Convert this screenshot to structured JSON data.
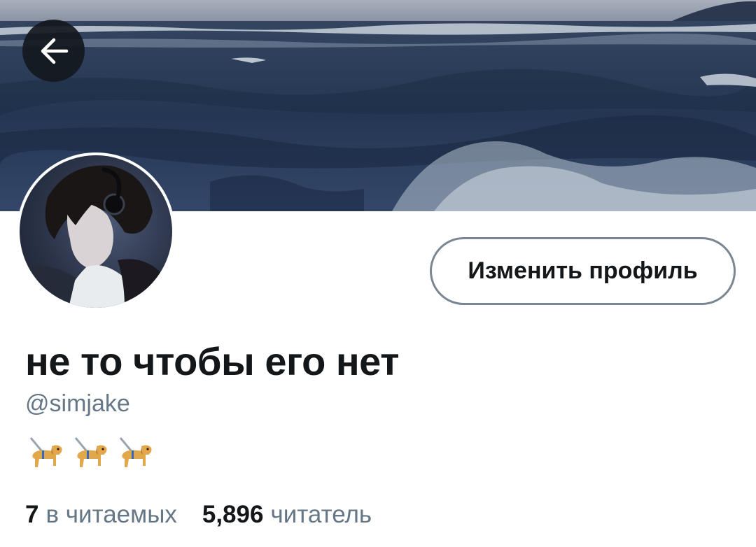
{
  "profile": {
    "display_name": "не то чтобы его нет",
    "handle": "@simjake",
    "bio_icons": [
      "guide-dog-emoji",
      "guide-dog-emoji",
      "guide-dog-emoji"
    ],
    "edit_button_label": "Изменить профиль"
  },
  "stats": {
    "following_count": "7",
    "following_label": "в читаемых",
    "followers_count": "5,896",
    "followers_label": "читатель"
  },
  "header": {
    "back_icon": "arrow-left-icon",
    "banner_image": "ocean-waves-banner"
  },
  "colors": {
    "text_primary": "#14171a",
    "text_secondary": "#657786",
    "button_border": "#7a8691",
    "banner_sea": "#2c3d58"
  }
}
